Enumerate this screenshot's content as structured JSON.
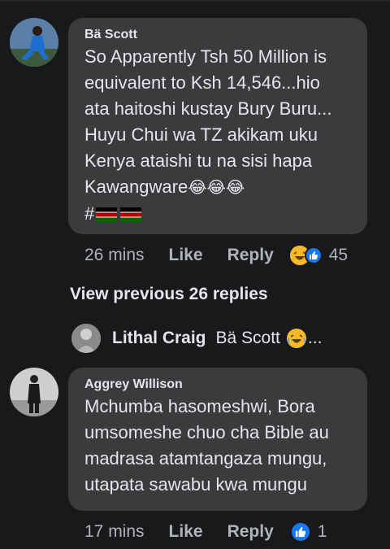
{
  "comments": [
    {
      "author": "Bä Scott",
      "text": "So Apparently Tsh 50 Million is\nequivalent to Ksh 14,546...hio\nata haitoshi kustay Bury Buru...\nHuyu Chui wa TZ akikam uku\nKenya ataishi tu na sisi hapa\nKawangware",
      "tail": "😂😂😂",
      "hashtag": "#",
      "time": "26 mins",
      "like_label": "Like",
      "reply_label": "Reply",
      "reaction_count": "45"
    },
    {
      "author": "Aggrey Willison",
      "text": "Mchumba hasomeshwi, Bora\numsomeshe chuo cha Bible au\nmadrasa atamtangaza mungu,\nutapata sawabu kwa mungu",
      "time": "17 mins",
      "like_label": "Like",
      "reply_label": "Reply",
      "reaction_count": "1"
    }
  ],
  "view_previous": "View previous 26 replies",
  "reply_preview": {
    "author": "Lithal Craig",
    "text": "Bä Scott",
    "suffix": "..."
  },
  "colors": {
    "background": "#18191a",
    "bubble": "#3a3b3c",
    "text": "#e4e6eb",
    "secondary": "#b0b3b8",
    "like_blue": "#1877f2",
    "haha_yellow": "#f7b928"
  }
}
